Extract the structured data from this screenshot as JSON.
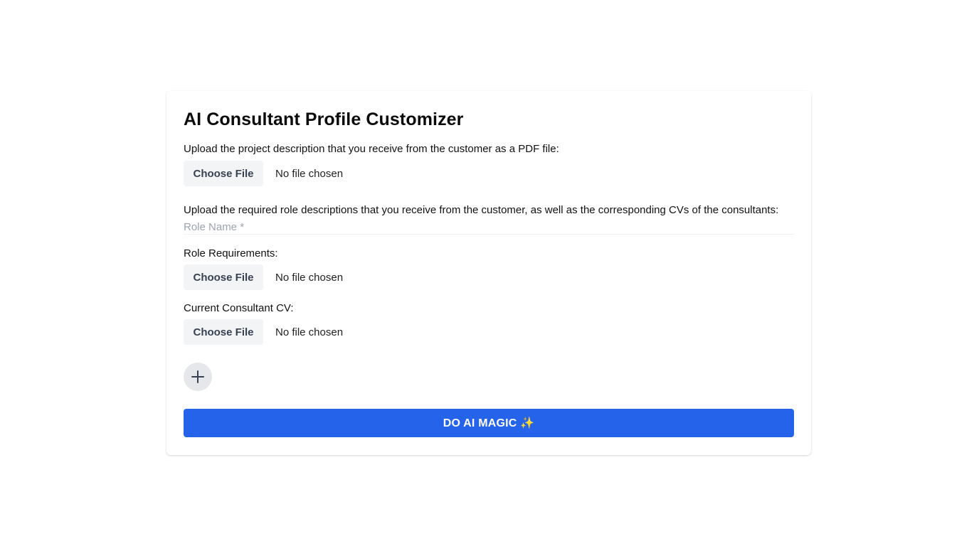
{
  "page": {
    "title": "AI Consultant Profile Customizer"
  },
  "project": {
    "label": "Upload the project description that you receive from the customer as a PDF file:",
    "button": "Choose File",
    "status": "No file chosen"
  },
  "roles": {
    "label": "Upload the required role descriptions that you receive from the customer, as well as the corresponding CVs of the consultants:",
    "role_name_placeholder": "Role Name *",
    "role_name_value": "",
    "requirements": {
      "label": "Role Requirements:",
      "button": "Choose File",
      "status": "No file chosen"
    },
    "cv": {
      "label": "Current Consultant CV:",
      "button": "Choose File",
      "status": "No file chosen"
    },
    "add_icon": "plus-icon"
  },
  "submit": {
    "label": "DO AI MAGIC ✨"
  },
  "colors": {
    "primary": "#2563eb",
    "file_button_bg": "#f3f4f6",
    "add_button_bg": "#e5e7eb",
    "placeholder": "#9ca3af"
  }
}
